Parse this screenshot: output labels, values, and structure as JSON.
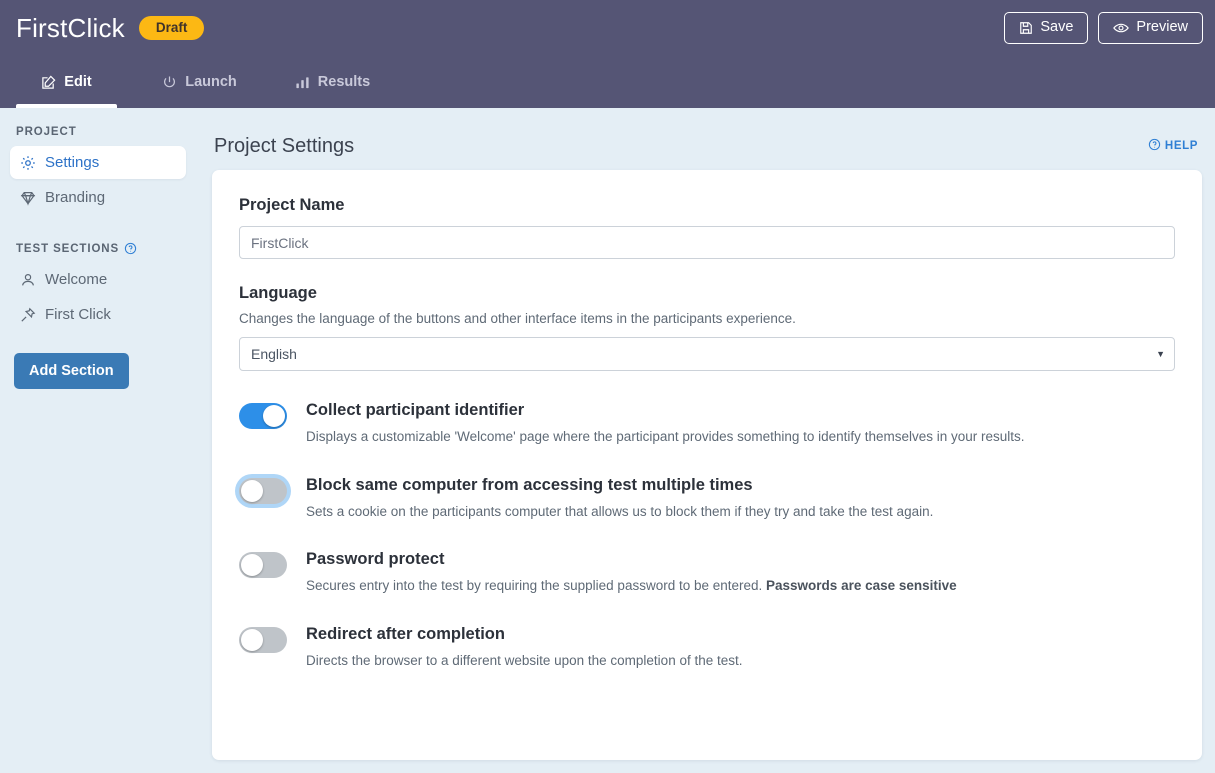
{
  "header": {
    "brand_title": "FirstClick",
    "status_badge": "Draft",
    "save_label": "Save",
    "preview_label": "Preview",
    "accent_color": "#555575",
    "badge_color": "#fcb814"
  },
  "tabs": [
    {
      "label": "Edit",
      "icon": "edit-icon",
      "active": true
    },
    {
      "label": "Launch",
      "icon": "power-icon",
      "active": false
    },
    {
      "label": "Results",
      "icon": "bar-chart-icon",
      "active": false
    }
  ],
  "sidebar": {
    "project_heading": "PROJECT",
    "test_sections_heading": "TEST SECTIONS",
    "project_items": [
      {
        "label": "Settings",
        "icon": "gear-icon",
        "active": true
      },
      {
        "label": "Branding",
        "icon": "gem-icon",
        "active": false
      }
    ],
    "section_items": [
      {
        "label": "Welcome",
        "icon": "person-icon"
      },
      {
        "label": "First Click",
        "icon": "pin-icon"
      }
    ],
    "add_section_label": "Add Section",
    "add_section_color": "#3a7ab5"
  },
  "main": {
    "page_title": "Project Settings",
    "help_label": "HELP",
    "project_name": {
      "label": "Project Name",
      "value": "FirstClick",
      "placeholder": "FirstClick"
    },
    "language": {
      "label": "Language",
      "description": "Changes the language of the buttons and other interface items in the participants experience.",
      "selected": "English",
      "options": [
        "English"
      ]
    },
    "toggles": [
      {
        "title": "Collect participant identifier",
        "description": "Displays a customizable 'Welcome' page where the participant provides something to identify themselves in your results.",
        "on": true,
        "focused": false
      },
      {
        "title": "Block same computer from accessing test multiple times",
        "description": "Sets a cookie on the participants computer that allows us to block them if they try and take the test again.",
        "on": false,
        "focused": true
      },
      {
        "title": "Password protect",
        "description": "Secures entry into the test by requiring the supplied password to be entered. ",
        "description_bold": "Passwords are case sensitive",
        "on": false,
        "focused": false
      },
      {
        "title": "Redirect after completion",
        "description": "Directs the browser to a different website upon the completion of the test.",
        "on": false,
        "focused": false
      }
    ]
  }
}
